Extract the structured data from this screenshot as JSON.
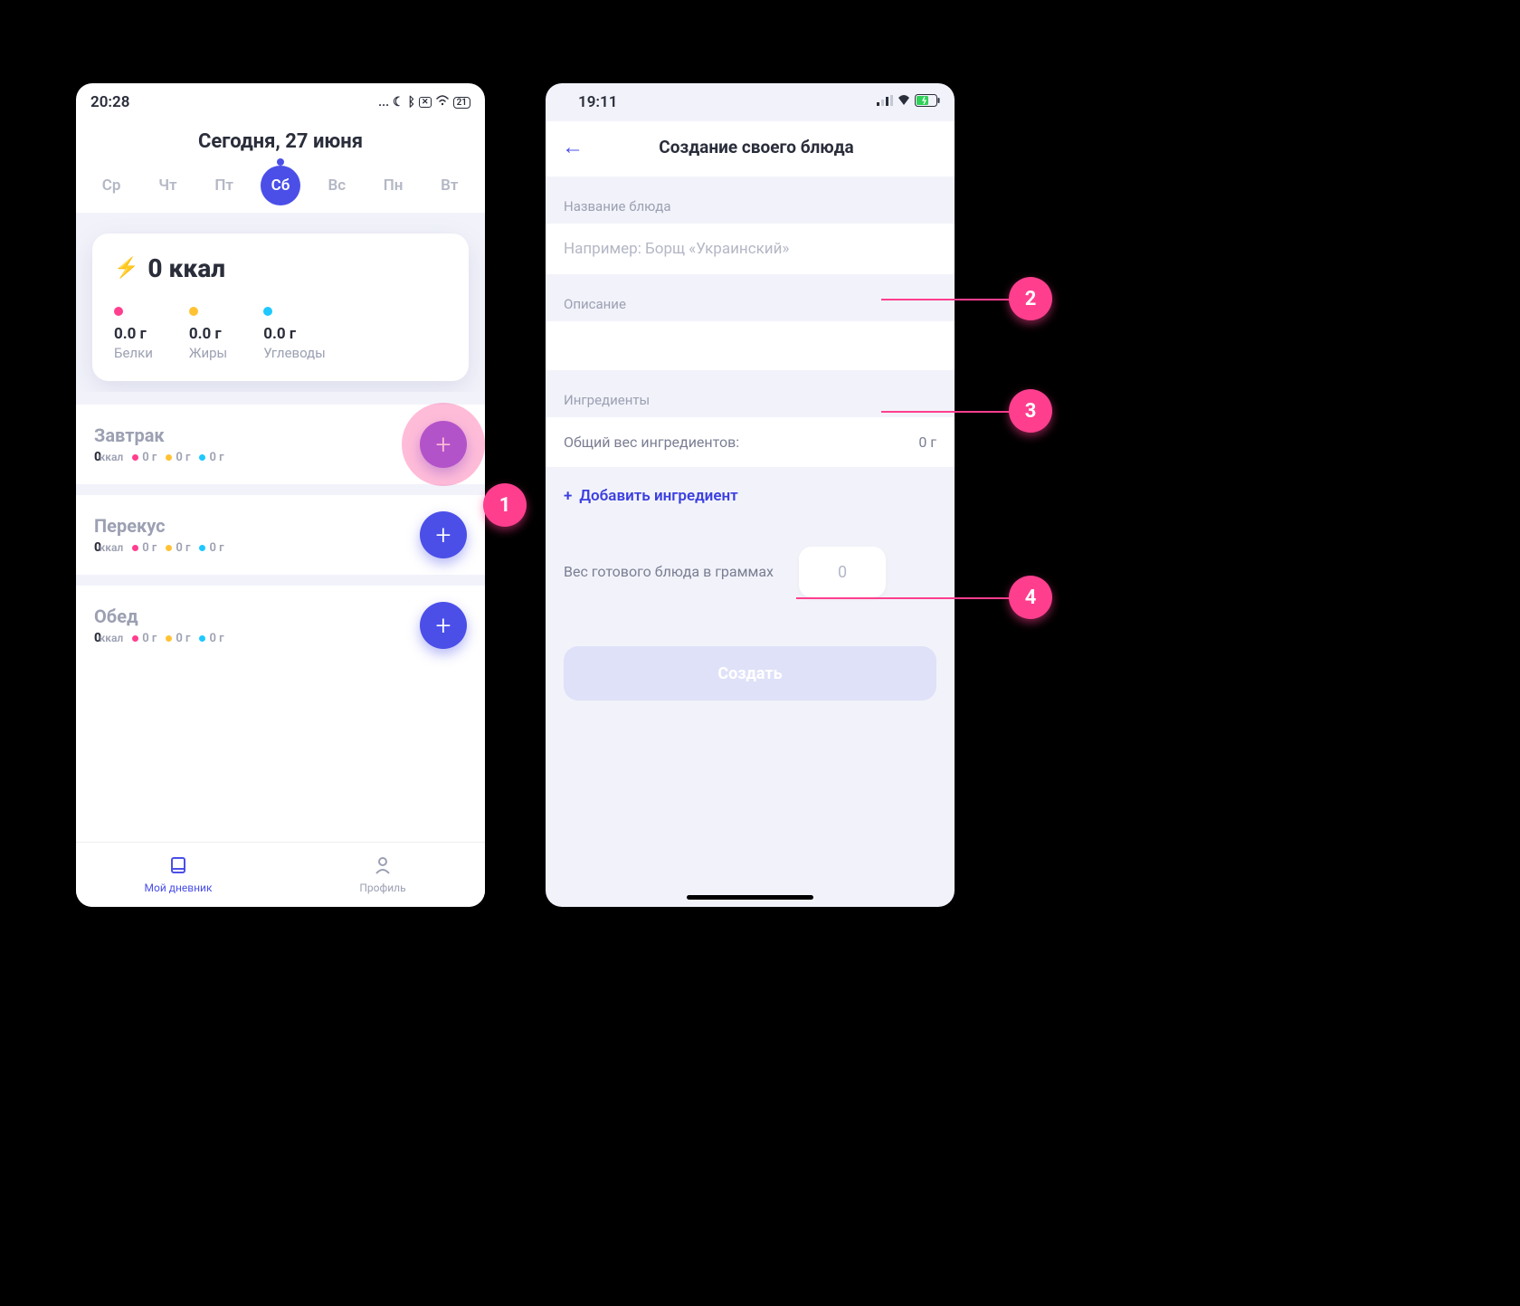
{
  "left": {
    "status": {
      "time": "20:28",
      "battery": "21"
    },
    "dateTitle": "Сегодня, 27 июня",
    "days": [
      "Ср",
      "Чт",
      "Пт",
      "Сб",
      "Вс",
      "Пн",
      "Вт"
    ],
    "activeDay": "Сб",
    "kcal": "0 ккал",
    "macros": [
      {
        "value": "0.0 г",
        "label": "Белки",
        "color": "pink"
      },
      {
        "value": "0.0 г",
        "label": "Жиры",
        "color": "yellow"
      },
      {
        "value": "0.0 г",
        "label": "Углеводы",
        "color": "cyan"
      }
    ],
    "meals": [
      {
        "name": "Завтрак",
        "kcal": "0",
        "unit": "ккал",
        "p": "0 г",
        "f": "0 г",
        "c": "0 г",
        "highlight": true
      },
      {
        "name": "Перекус",
        "kcal": "0",
        "unit": "ккал",
        "p": "0 г",
        "f": "0 г",
        "c": "0 г",
        "highlight": false
      },
      {
        "name": "Обед",
        "kcal": "0",
        "unit": "ккал",
        "p": "0 г",
        "f": "0 г",
        "c": "0 г",
        "highlight": false
      }
    ],
    "nav": {
      "diary": "Мой дневник",
      "profile": "Профиль"
    }
  },
  "right": {
    "status": {
      "time": "19:11"
    },
    "title": "Создание своего блюда",
    "dishNameLabel": "Название блюда",
    "dishNamePlaceholder": "Например: Борщ «Украинский»",
    "descLabel": "Описание",
    "ingredientsLabel": "Ингредиенты",
    "totalLabel": "Общий вес ингредиентов:",
    "totalValue": "0 г",
    "addIngredient": "Добавить ингредиент",
    "weightLabel": "Вес готового блюда в граммах",
    "weightPlaceholder": "0",
    "createBtn": "Создать"
  },
  "annotations": [
    "1",
    "2",
    "3",
    "4"
  ]
}
